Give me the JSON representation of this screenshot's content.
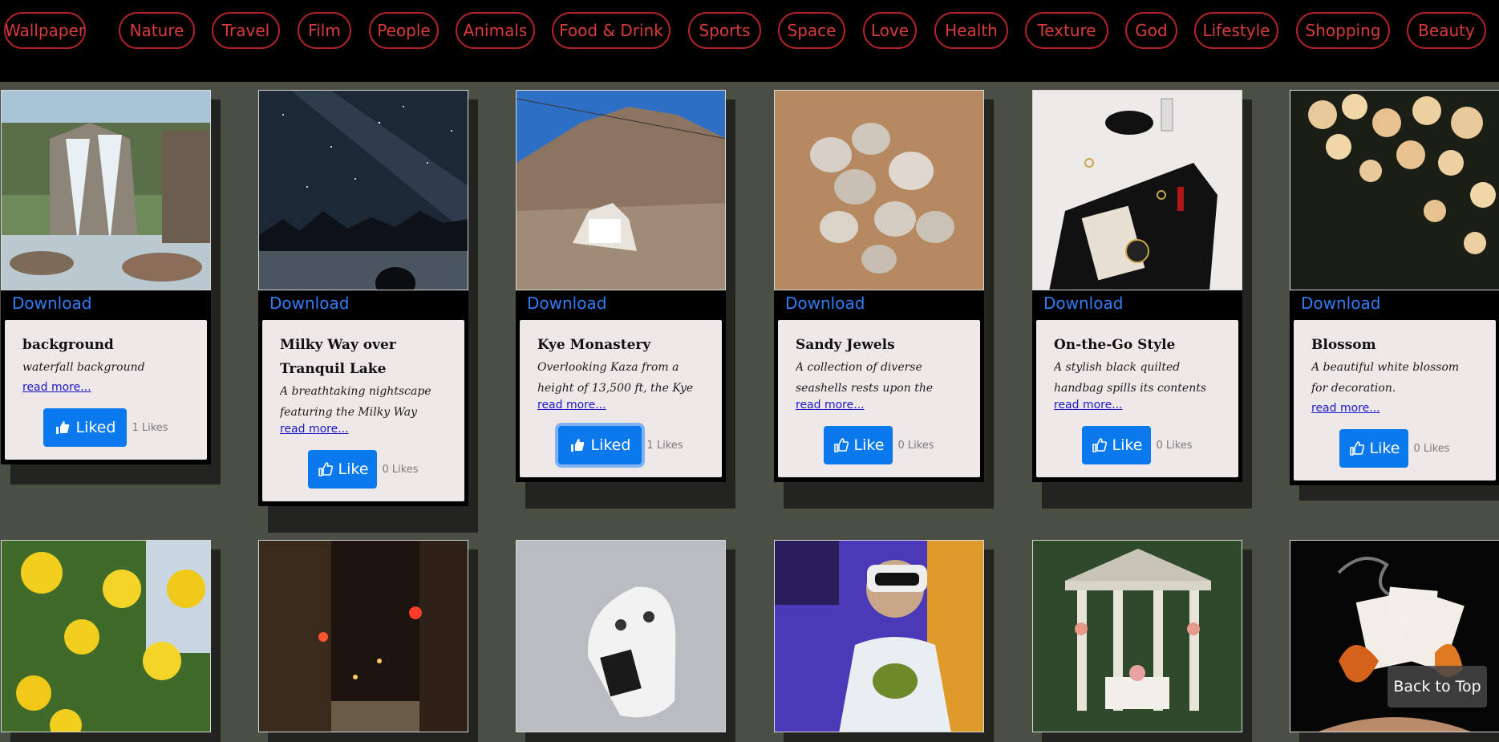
{
  "categories": [
    "Wallpaper",
    "Nature",
    "Travel",
    "Film",
    "People",
    "Animals",
    "Food & Drink",
    "Sports",
    "Space",
    "Love",
    "Health",
    "Texture",
    "God",
    "Lifestyle",
    "Shopping",
    "Beauty"
  ],
  "download_label": "Download",
  "read_more_label": "read more...",
  "cards": [
    {
      "title": "background",
      "desc": "waterfall background",
      "like_label": "Liked",
      "likes": "1 Likes",
      "image": "waterfall-image"
    },
    {
      "title": "Milky Way over Tranquil Lake",
      "desc": "A breathtaking nightscape featuring the Milky Way",
      "like_label": "Like",
      "likes": "0 Likes",
      "image": "milky-way-image"
    },
    {
      "title": "Kye Monastery",
      "desc": "Overlooking Kaza from a height of 13,500 ft, the Kye",
      "like_label": "Liked",
      "likes": "1 Likes",
      "image": "monastery-image"
    },
    {
      "title": "Sandy Jewels",
      "desc": "A collection of diverse seashells rests upon the warm",
      "like_label": "Like",
      "likes": "0 Likes",
      "image": "seashells-image"
    },
    {
      "title": "On-the-Go Style",
      "desc": "A stylish black quilted handbag spills its contents",
      "like_label": "Like",
      "likes": "0 Likes",
      "image": "handbag-image"
    },
    {
      "title": "Blossom",
      "desc": "A beautiful white blossom for decoration.",
      "like_label": "Like",
      "likes": "0 Likes",
      "image": "blossom-image"
    }
  ],
  "row2_images": [
    "yellow-roses-image",
    "night-street-image",
    "game-controller-image",
    "vr-headset-image",
    "gazebo-image",
    "burning-cards-image"
  ],
  "back_to_top_label": "Back to Top",
  "colors": {
    "nav_border": "#b1232a",
    "nav_text": "#d73b3b",
    "download": "#2f7cf6",
    "like_button": "#0b79ee",
    "card_bg": "#efe8e8",
    "page_bg": "#4a4f43"
  }
}
